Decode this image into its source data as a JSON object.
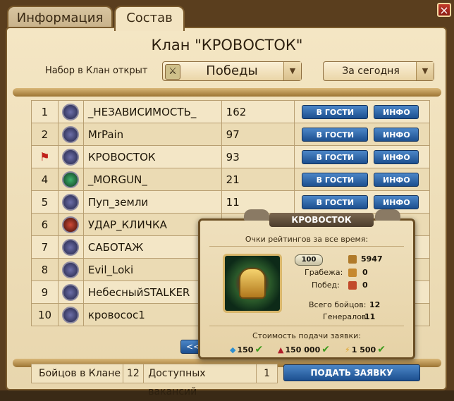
{
  "tabs": {
    "info": "Информация",
    "members": "Состав"
  },
  "close_label": "×",
  "clan_title": "Клан \"КРОВОСТОК\"",
  "recruit_text": "Набор в Клан открыт",
  "filter": {
    "criterion": "Победы",
    "period": "За сегодня"
  },
  "buttons": {
    "visit": "В ГОСТИ",
    "info": "ИНФО",
    "prev": "<<",
    "apply": "ПОДАТЬ ЗАЯВКУ"
  },
  "rows": [
    {
      "rank": "1",
      "name": "_НЕЗАВИСИМОСТЬ_",
      "score": "162",
      "emblem": "purple"
    },
    {
      "rank": "2",
      "name": "MrPain",
      "score": "97",
      "emblem": "purple"
    },
    {
      "rank": "",
      "name": "КРОВОСТОК",
      "score": "93",
      "emblem": "purple",
      "flag": true
    },
    {
      "rank": "4",
      "name": "_MORGUN_",
      "score": "21",
      "emblem": "green"
    },
    {
      "rank": "5",
      "name": "Пуп_земли",
      "score": "11",
      "emblem": "purple"
    },
    {
      "rank": "6",
      "name": "УДАР_КЛИЧКА",
      "score": "",
      "emblem": "red"
    },
    {
      "rank": "7",
      "name": "САБОТАЖ",
      "score": "",
      "emblem": "purple"
    },
    {
      "rank": "8",
      "name": "Evil_Loki",
      "score": "",
      "emblem": "purple"
    },
    {
      "rank": "9",
      "name": "НебесныйSTALKER",
      "score": "",
      "emblem": "purple"
    },
    {
      "rank": "10",
      "name": "кровосос1",
      "score": "",
      "emblem": "purple"
    }
  ],
  "footer": {
    "fighters_label": "Бойцов в Клане",
    "fighters": "12",
    "vacancies_label": "Доступных вакансий",
    "vacancies": "1"
  },
  "popup": {
    "title": "КРОВОСТОК",
    "rating_label": "Очки рейтингов за все время:",
    "badge": "100",
    "rating": "5947",
    "robbery_label": "Грабежа:",
    "robbery": "0",
    "wins_label": "Побед:",
    "wins": "0",
    "fighters_label": "Всего бойцов:",
    "fighters": "12",
    "generals_label": "Генералов:",
    "generals": "11",
    "cost_label": "Стоимость подачи заявки:",
    "cost_crystals": "150",
    "cost_blood": "150 000",
    "cost_energy": "1 500"
  }
}
